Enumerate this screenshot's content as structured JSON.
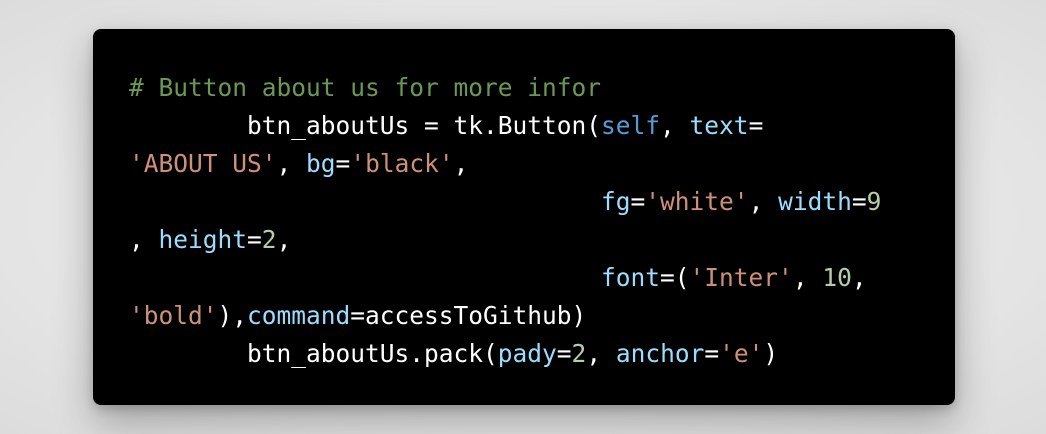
{
  "code_block": {
    "lines": [
      [
        {
          "t": "# Button about us for more infor",
          "k": "comment"
        }
      ],
      [
        {
          "t": "        btn_aboutUs = tk.Button(",
          "k": "plain"
        },
        {
          "t": "self",
          "k": "self"
        },
        {
          "t": ", ",
          "k": "plain"
        },
        {
          "t": "text",
          "k": "param"
        },
        {
          "t": "=",
          "k": "plain"
        }
      ],
      [
        {
          "t": "'ABOUT US'",
          "k": "string"
        },
        {
          "t": ", ",
          "k": "plain"
        },
        {
          "t": "bg",
          "k": "param"
        },
        {
          "t": "=",
          "k": "plain"
        },
        {
          "t": "'black'",
          "k": "string"
        },
        {
          "t": ",",
          "k": "plain"
        }
      ],
      [
        {
          "t": "                                ",
          "k": "plain"
        },
        {
          "t": "fg",
          "k": "param"
        },
        {
          "t": "=",
          "k": "plain"
        },
        {
          "t": "'white'",
          "k": "string"
        },
        {
          "t": ", ",
          "k": "plain"
        },
        {
          "t": "width",
          "k": "param"
        },
        {
          "t": "=",
          "k": "plain"
        },
        {
          "t": "9",
          "k": "number"
        }
      ],
      [
        {
          "t": ", ",
          "k": "plain"
        },
        {
          "t": "height",
          "k": "param"
        },
        {
          "t": "=",
          "k": "plain"
        },
        {
          "t": "2",
          "k": "number"
        },
        {
          "t": ",",
          "k": "plain"
        }
      ],
      [
        {
          "t": "                                ",
          "k": "plain"
        },
        {
          "t": "font",
          "k": "param"
        },
        {
          "t": "=(",
          "k": "plain"
        },
        {
          "t": "'Inter'",
          "k": "string"
        },
        {
          "t": ", ",
          "k": "plain"
        },
        {
          "t": "10",
          "k": "number"
        },
        {
          "t": ",",
          "k": "plain"
        }
      ],
      [
        {
          "t": "'bold'",
          "k": "string"
        },
        {
          "t": "),",
          "k": "plain"
        },
        {
          "t": "command",
          "k": "param"
        },
        {
          "t": "=accessToGithub)",
          "k": "plain"
        }
      ],
      [
        {
          "t": "        btn_aboutUs.pack(",
          "k": "plain"
        },
        {
          "t": "pady",
          "k": "param"
        },
        {
          "t": "=",
          "k": "plain"
        },
        {
          "t": "2",
          "k": "number"
        },
        {
          "t": ", ",
          "k": "plain"
        },
        {
          "t": "anchor",
          "k": "param"
        },
        {
          "t": "=",
          "k": "plain"
        },
        {
          "t": "'e'",
          "k": "string"
        },
        {
          "t": ")",
          "k": "plain"
        }
      ]
    ]
  },
  "colors": {
    "page_background": "#e6e6e6",
    "card_background": "#000000",
    "comment": "#6a9955",
    "plain": "#ffffff",
    "self_keyword": "#569cd6",
    "parameter": "#9cdcfe",
    "string": "#ce9178",
    "number": "#b5cea8"
  }
}
